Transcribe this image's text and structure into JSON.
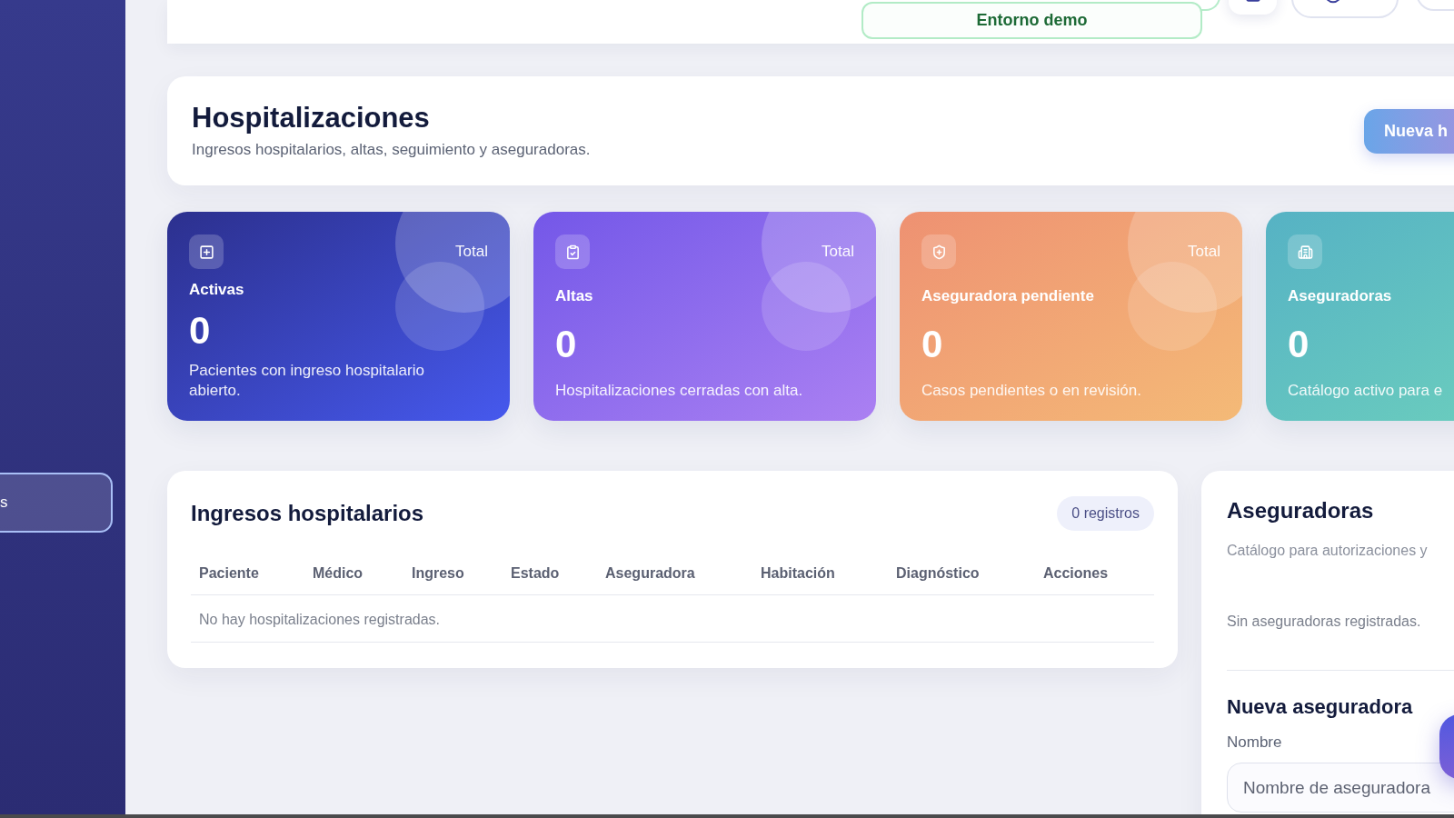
{
  "sidebar": {
    "items": [
      {
        "label": "s",
        "selected": true
      }
    ]
  },
  "top_bar": {
    "environment_badge": "Entorno demo"
  },
  "header": {
    "title": "Hospitalizaciones",
    "subtitle": "Ingresos hospitalarios, altas, seguimiento y aseguradoras.",
    "primary_button": "Nueva h"
  },
  "stat_cards": [
    {
      "kind": "active",
      "title": "Activas",
      "period": "Total",
      "value": "0",
      "description": "Pacientes con ingreso hospitalario abierto."
    },
    {
      "kind": "discharged",
      "title": "Altas",
      "period": "Total",
      "value": "0",
      "description": "Hospitalizaciones cerradas con alta."
    },
    {
      "kind": "pending",
      "title": "Aseguradora pendiente",
      "period": "Total",
      "value": "0",
      "description": "Casos pendientes o en revisión."
    },
    {
      "kind": "insurers",
      "title": "Aseguradoras",
      "value": "0",
      "description": "Catálogo activo para e"
    }
  ],
  "admissions": {
    "title": "Ingresos hospitalarios",
    "count_badge": "0 registros",
    "columns": [
      "Paciente",
      "Médico",
      "Ingreso",
      "Estado",
      "Aseguradora",
      "Habitación",
      "Diagnóstico",
      "Acciones"
    ],
    "empty_message": "No hay hospitalizaciones registradas."
  },
  "insurers": {
    "title": "Aseguradoras",
    "subtitle": "Catálogo para autorizaciones y",
    "empty_message": "Sin aseguradoras registradas.",
    "form": {
      "title": "Nueva aseguradora",
      "fields": [
        {
          "label": "Nombre",
          "placeholder": "Nombre de aseguradora"
        }
      ]
    }
  }
}
